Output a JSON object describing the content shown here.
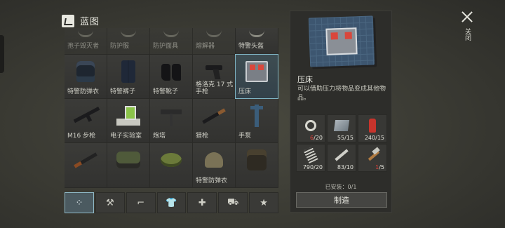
{
  "header": {
    "title": "蓝图",
    "icon": "blueprint-icon"
  },
  "grid": {
    "rows": [
      [
        {
          "label": "孢子毁灭者",
          "art": "ghost",
          "dim": true
        },
        {
          "label": "防护服",
          "art": "ghost",
          "dim": true
        },
        {
          "label": "防护面具",
          "art": "ghost",
          "dim": true
        },
        {
          "label": "熔解器",
          "art": "ghost",
          "dim": true
        },
        {
          "label": "特警头盔",
          "art": "ghost",
          "dim": false
        }
      ],
      [
        {
          "label": "特警防弹衣",
          "art": "vest"
        },
        {
          "label": "特警裤子",
          "art": "pants"
        },
        {
          "label": "特警靴子",
          "art": "boots"
        },
        {
          "label": "格洛克 17 式手枪",
          "art": "pistol"
        },
        {
          "label": "压床",
          "art": "press",
          "selected": true
        }
      ],
      [
        {
          "label": "M16 步枪",
          "art": "rifle"
        },
        {
          "label": "电子实验室",
          "art": "lab"
        },
        {
          "label": "炮塔",
          "art": "turret"
        },
        {
          "label": "猎枪",
          "art": "shotgun"
        },
        {
          "label": "手泵",
          "art": "pump"
        }
      ],
      [
        {
          "label": "",
          "art": "ak"
        },
        {
          "label": "",
          "art": "tank"
        },
        {
          "label": "",
          "art": "mine"
        },
        {
          "label": "特警防弹衣",
          "art": "helmet"
        },
        {
          "label": "",
          "art": "vest2"
        }
      ]
    ]
  },
  "tabs": [
    {
      "name": "tab-all",
      "glyph": "⁘",
      "active": true
    },
    {
      "name": "tab-tools",
      "glyph": "⚒",
      "active": false
    },
    {
      "name": "tab-weapons",
      "glyph": "⌐",
      "active": false
    },
    {
      "name": "tab-clothing",
      "glyph": "👕",
      "active": false
    },
    {
      "name": "tab-medicine",
      "glyph": "✚",
      "active": false
    },
    {
      "name": "tab-vehicles",
      "glyph": "⛟",
      "active": false
    },
    {
      "name": "tab-favorites",
      "glyph": "★",
      "active": false
    }
  ],
  "detail": {
    "name": "压床",
    "description": "可以借助压力将物品变成其他物品。",
    "materials": [
      {
        "icon": "bearing-icon",
        "have": "6",
        "need": "20",
        "low": true
      },
      {
        "icon": "metal-sheet-icon",
        "have": "55",
        "need": "15",
        "low": false
      },
      {
        "icon": "fire-extinguisher-icon",
        "have": "240",
        "need": "15",
        "low": false
      },
      {
        "icon": "spring-icon",
        "have": "790",
        "need": "20",
        "low": false
      },
      {
        "icon": "wrench-icon",
        "have": "83",
        "need": "10",
        "low": false
      },
      {
        "icon": "hammer-icon",
        "have": "1",
        "need": "5",
        "low": true
      }
    ],
    "installed": "已安装：0/1",
    "craft_label": "制造"
  },
  "close": {
    "label": "关闭"
  },
  "colors": {
    "selected_border": "#7fb4c4",
    "low_stock": "#e0403a"
  }
}
